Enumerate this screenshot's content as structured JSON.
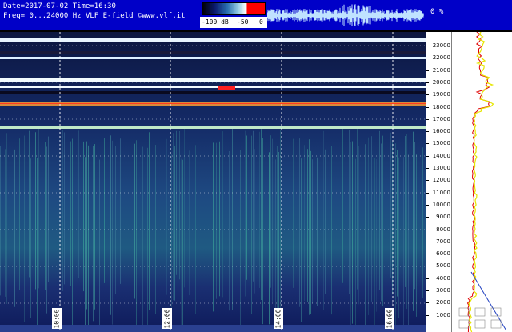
{
  "header": {
    "date_line": "Date=2017-07-02 Time=16:30",
    "freq_line": "Freq= 0...24000 Hz   VLF E-field ©www.vlf.it",
    "scale_labels": [
      "-100 dB",
      "-50",
      "0"
    ],
    "percent": "0 %"
  },
  "frequency_axis": {
    "labels": [
      "23000",
      "22000",
      "21000",
      "20000",
      "19000",
      "18000",
      "17000",
      "16000",
      "15000",
      "14000",
      "13000",
      "12000",
      "11000",
      "10000",
      "9000",
      "8000",
      "7000",
      "6000",
      "5000",
      "4000",
      "3000",
      "2000",
      "1000"
    ]
  },
  "time_axis": {
    "labels": [
      "10:00",
      "12:00",
      "14:00",
      "16:00"
    ]
  },
  "colors": {
    "header_bg": "#0000c8",
    "marker_red": "#ff0000",
    "profile_yellow": "#e6e600"
  }
}
